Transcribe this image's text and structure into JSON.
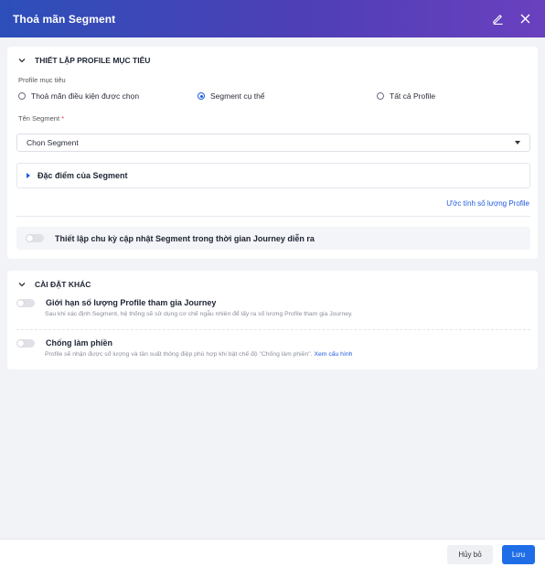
{
  "header": {
    "title": "Thoả mãn Segment",
    "edit_icon": "pencil-icon",
    "close_icon": "close-icon"
  },
  "target_profile": {
    "section_title": "THIẾT LẬP PROFILE MỤC TIÊU",
    "profile_label": "Profile mục tiêu",
    "radio_options": [
      {
        "label": "Thoả mãn điều kiện được chọn",
        "checked": false
      },
      {
        "label": "Segment cụ thể",
        "checked": true
      },
      {
        "label": "Tất cả Profile",
        "checked": false
      }
    ],
    "segment_name_label": "Tên Segment",
    "required_mark": "*",
    "segment_select_value": "Chọn Segment",
    "segment_features_label": "Đặc điểm của Segment",
    "estimate_link": "Ước tính số lượng Profile",
    "schedule_toggle_label": "Thiết lập chu kỳ cập nhật Segment trong thời gian Journey diễn ra",
    "schedule_toggle_on": false
  },
  "other_settings": {
    "section_title": "CÀI ĐẶT KHÁC",
    "limit_toggle_label": "Giới hạn số lượng Profile tham gia Journey",
    "limit_toggle_on": false,
    "limit_description": "Sau khi xác định Segment, hệ thống sẽ sử dụng cơ chế ngẫu nhiên để lấy ra số lượng Profile tham gia Journey.",
    "anti_spam_toggle_label": "Chống làm phiền",
    "anti_spam_toggle_on": false,
    "anti_spam_description": "Profile sẽ nhận được số lượng và tần suất thông điệp phù hợp khi bật chế độ \"Chống làm phiền\".",
    "anti_spam_link": "Xem cấu hình"
  },
  "footer": {
    "cancel_label": "Hủy bỏ",
    "save_label": "Lưu"
  },
  "colors": {
    "header_start": "#2c4fb9",
    "header_end": "#6a40bf",
    "accent": "#1f6ee8",
    "required": "#e5383b"
  }
}
